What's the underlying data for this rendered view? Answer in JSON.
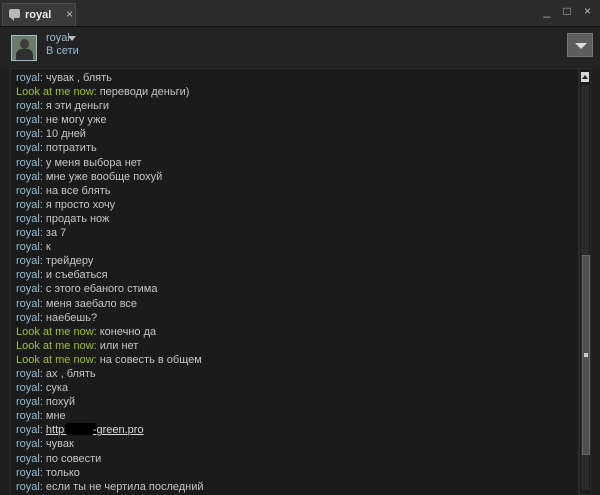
{
  "window": {
    "tab_title": "royal",
    "tab_close": "×",
    "controls": [
      "_",
      "□",
      "×"
    ]
  },
  "header": {
    "username": "royal",
    "status": "В сети"
  },
  "colors": {
    "self_name": "#8fbcd6",
    "friend_name": "#9dc03a",
    "text": "#c6c6c6",
    "background": "#1b1b1b"
  },
  "messages": [
    {
      "sender": "royal",
      "kind": "me",
      "text": "чувак , блять"
    },
    {
      "sender": "Look at me now",
      "kind": "other",
      "text": "переводи деньги)"
    },
    {
      "sender": "royal",
      "kind": "me",
      "text": "я эти деньги"
    },
    {
      "sender": "royal",
      "kind": "me",
      "text": "не могу уже"
    },
    {
      "sender": "royal",
      "kind": "me",
      "text": "10 дней"
    },
    {
      "sender": "royal",
      "kind": "me",
      "text": "потратить"
    },
    {
      "sender": "royal",
      "kind": "me",
      "text": "у меня выбора нет"
    },
    {
      "sender": "royal",
      "kind": "me",
      "text": "мне уже вообще похуй"
    },
    {
      "sender": "royal",
      "kind": "me",
      "text": "на все блять"
    },
    {
      "sender": "royal",
      "kind": "me",
      "text": "я просто хочу"
    },
    {
      "sender": "royal",
      "kind": "me",
      "text": "продать нож"
    },
    {
      "sender": "royal",
      "kind": "me",
      "text": "за 7"
    },
    {
      "sender": "royal",
      "kind": "me",
      "text": "к"
    },
    {
      "sender": "royal",
      "kind": "me",
      "text": "трейдеру"
    },
    {
      "sender": "royal",
      "kind": "me",
      "text": "и съебаться"
    },
    {
      "sender": "royal",
      "kind": "me",
      "text": "с этого ебаного стима"
    },
    {
      "sender": "royal",
      "kind": "me",
      "text": "меня заебало все"
    },
    {
      "sender": "royal",
      "kind": "me",
      "text": "наебешь?"
    },
    {
      "sender": "Look at me now",
      "kind": "other",
      "text": "конечно да"
    },
    {
      "sender": "Look at me now",
      "kind": "other",
      "text": "или нет"
    },
    {
      "sender": "Look at me now",
      "kind": "other",
      "text": "на совесть в общем"
    },
    {
      "sender": "royal",
      "kind": "me",
      "text": "ах , блять"
    },
    {
      "sender": "royal",
      "kind": "me",
      "text": "сука"
    },
    {
      "sender": "royal",
      "kind": "me",
      "text": "похуй"
    },
    {
      "sender": "royal",
      "kind": "me",
      "text": "мне"
    },
    {
      "sender": "royal",
      "kind": "me",
      "link_prefix": "https:",
      "link_suffix": "-green.pro"
    },
    {
      "sender": "royal",
      "kind": "me",
      "text": "чувак"
    },
    {
      "sender": "royal",
      "kind": "me",
      "text": "по совести"
    },
    {
      "sender": "royal",
      "kind": "me",
      "text": "только"
    },
    {
      "sender": "royal",
      "kind": "me",
      "text": "если ты не чертила последний"
    }
  ]
}
